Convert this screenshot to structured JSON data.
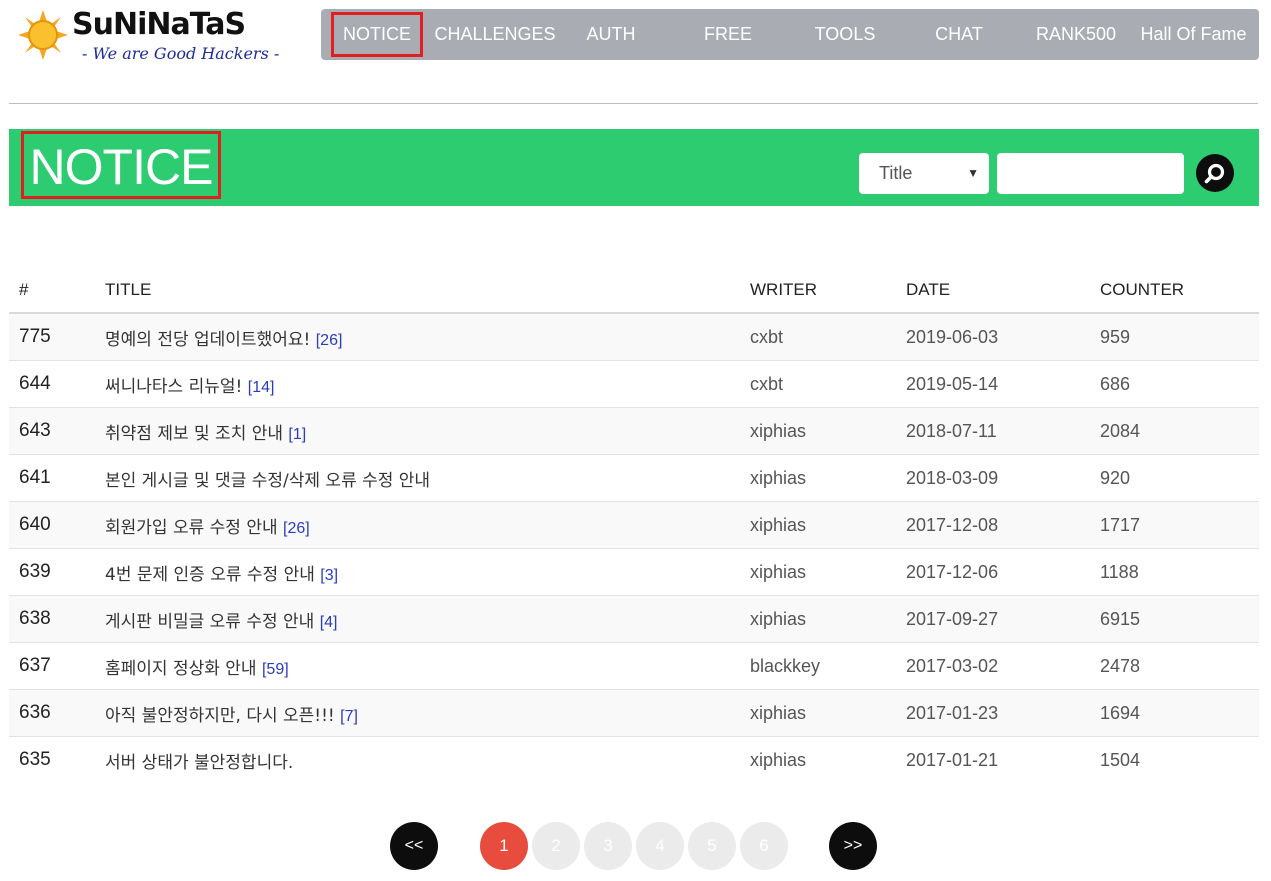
{
  "brand": {
    "name": "SuNiNaTaS",
    "tagline": "- We are Good Hackers -"
  },
  "nav": {
    "items": [
      {
        "label": "NOTICE",
        "active": true
      },
      {
        "label": "CHALLENGES"
      },
      {
        "label": "AUTH"
      },
      {
        "label": "FREE"
      },
      {
        "label": "TOOLS"
      },
      {
        "label": "CHAT"
      },
      {
        "label": "RANK500"
      },
      {
        "label": "Hall Of Fame"
      }
    ]
  },
  "page": {
    "title": "NOTICE",
    "accent_color": "#2ecc71",
    "highlight_color": "#e02020"
  },
  "search": {
    "field_option": "Title",
    "query": ""
  },
  "table": {
    "headers": [
      "#",
      "TITLE",
      "WRITER",
      "DATE",
      "COUNTER"
    ],
    "rows": [
      {
        "num": "775",
        "title": "명예의 전당 업데이트했어요!",
        "comments": "[26]",
        "writer": "cxbt",
        "date": "2019-06-03",
        "counter": "959"
      },
      {
        "num": "644",
        "title": "써니나타스 리뉴얼!",
        "comments": "[14]",
        "writer": "cxbt",
        "date": "2019-05-14",
        "counter": "686"
      },
      {
        "num": "643",
        "title": "취약점 제보 및 조치 안내",
        "comments": "[1]",
        "writer": "xiphias",
        "date": "2018-07-11",
        "counter": "2084"
      },
      {
        "num": "641",
        "title": "본인 게시글 및 댓글 수정/삭제 오류 수정 안내",
        "comments": "",
        "writer": "xiphias",
        "date": "2018-03-09",
        "counter": "920"
      },
      {
        "num": "640",
        "title": "회원가입 오류 수정 안내",
        "comments": "[26]",
        "writer": "xiphias",
        "date": "2017-12-08",
        "counter": "1717"
      },
      {
        "num": "639",
        "title": "4번 문제 인증 오류 수정 안내",
        "comments": "[3]",
        "writer": "xiphias",
        "date": "2017-12-06",
        "counter": "1188"
      },
      {
        "num": "638",
        "title": "게시판 비밀글 오류 수정 안내",
        "comments": "[4]",
        "writer": "xiphias",
        "date": "2017-09-27",
        "counter": "6915"
      },
      {
        "num": "637",
        "title": "홈페이지 정상화 안내",
        "comments": "[59]",
        "writer": "blackkey",
        "date": "2017-03-02",
        "counter": "2478"
      },
      {
        "num": "636",
        "title": "아직 불안정하지만, 다시 오픈!!!",
        "comments": "[7]",
        "writer": "xiphias",
        "date": "2017-01-23",
        "counter": "1694"
      },
      {
        "num": "635",
        "title": "서버 상태가 불안정합니다.",
        "comments": "",
        "writer": "xiphias",
        "date": "2017-01-21",
        "counter": "1504"
      }
    ]
  },
  "pagination": {
    "prev_label": "<<",
    "next_label": ">>",
    "pages": [
      "1",
      "2",
      "3",
      "4",
      "5",
      "6"
    ],
    "current": "1"
  }
}
